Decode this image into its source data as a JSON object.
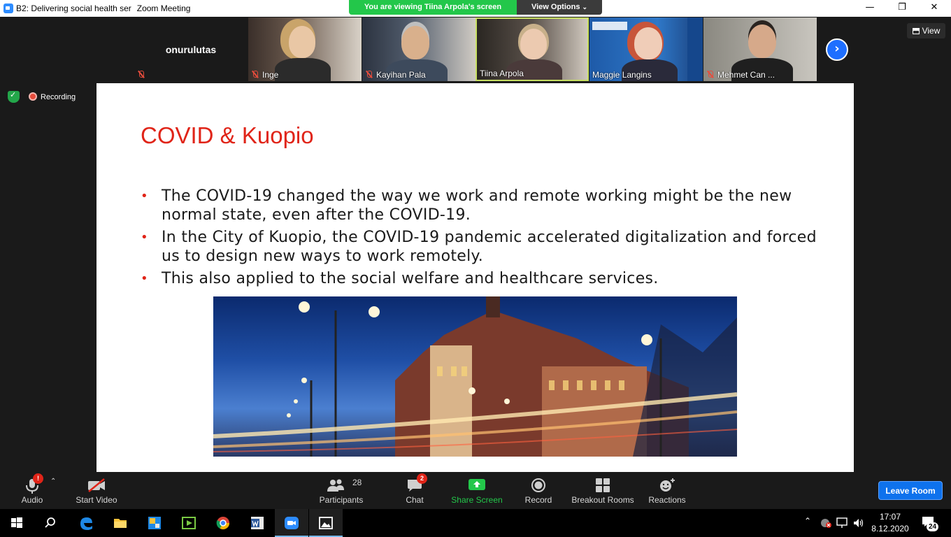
{
  "window": {
    "title_left": "B2: Delivering social health ser",
    "title_right": "Zoom Meeting",
    "minimize_icon": "—",
    "maximize_icon": "❐",
    "close_icon": "✕"
  },
  "banner": {
    "viewing_text": "You are viewing Tiina Arpola's screen",
    "view_options_label": "View Options"
  },
  "gallery": {
    "participants": [
      {
        "name": "onurulutas",
        "video": false
      },
      {
        "name": "Inge",
        "video": true
      },
      {
        "name": "Kayihan Pala",
        "video": true
      },
      {
        "name": "Tiina Arpola",
        "video": true,
        "active_speaker": true
      },
      {
        "name": "Maggie Langins",
        "video": true
      },
      {
        "name": "Mehmet Can ...",
        "video": true
      }
    ],
    "next_arrow": "›",
    "view_label": "View"
  },
  "status": {
    "recording_label": "Recording"
  },
  "slide": {
    "title": "COVID & Kuopio",
    "bullets": [
      "The COVID-19 changed the way we work and remote working might be the new normal state, even after the COVID-19.",
      "In the City of Kuopio, the COVID-19 pandemic accelerated digitalization and forced us to design new ways to work remotely.",
      "This also applied to the social welfare and healthcare services."
    ]
  },
  "toolbar": {
    "audio_label": "Audio",
    "audio_badge": "!",
    "start_video_label": "Start Video",
    "participants_label": "Participants",
    "participants_count": "28",
    "chat_label": "Chat",
    "chat_badge": "2",
    "share_screen_label": "Share Screen",
    "record_label": "Record",
    "breakout_label": "Breakout Rooms",
    "reactions_label": "Reactions",
    "leave_label": "Leave Room"
  },
  "taskbar": {
    "time": "17:07",
    "date": "8.12.2020",
    "notifications_count": "24"
  },
  "colors": {
    "slide_title": "#e02418",
    "banner_green": "#23c74a",
    "leave_blue": "#0e72ed",
    "accent_blue": "#1e6fff"
  }
}
